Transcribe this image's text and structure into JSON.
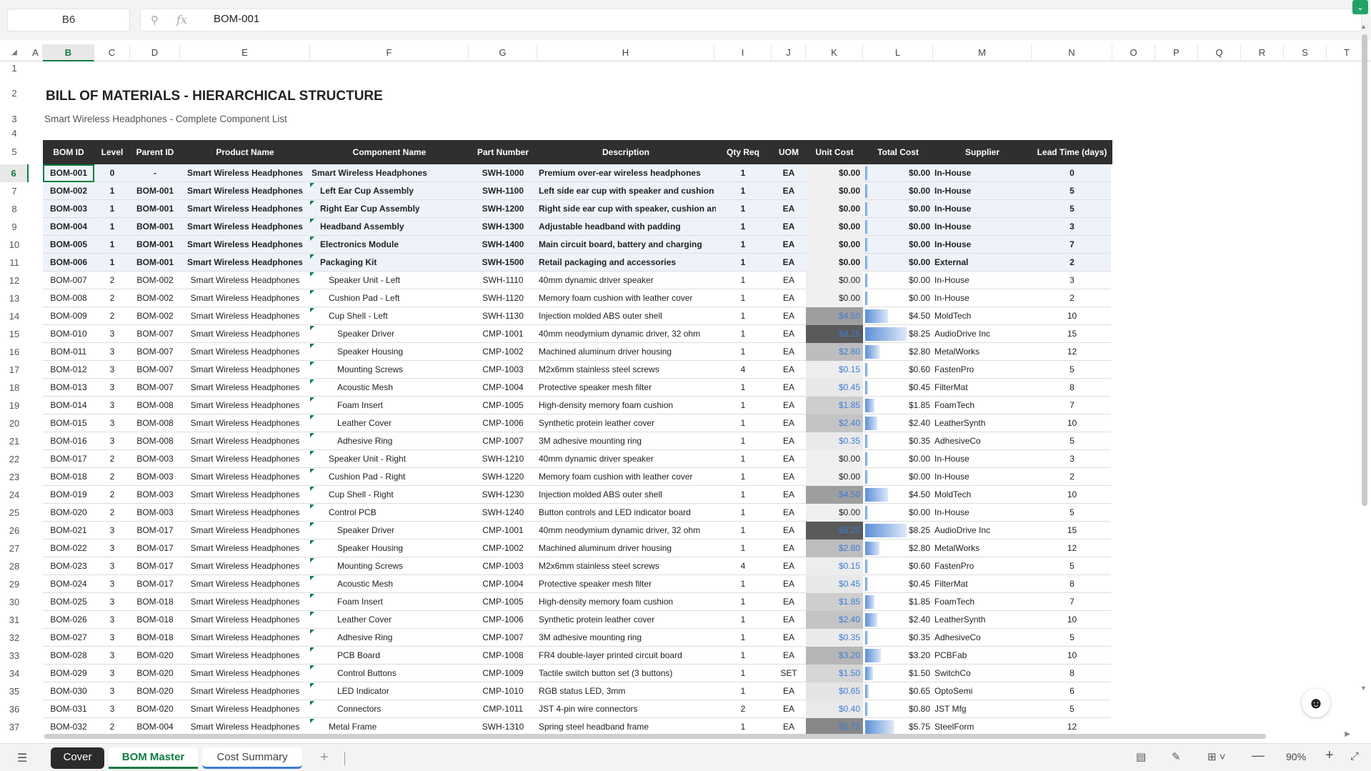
{
  "formula_bar": {
    "cell_ref": "B6",
    "fx_label": "fx",
    "formula_value": "BOM-001",
    "expand_icon": "chevron-down-icon"
  },
  "columns": [
    "A",
    "B",
    "C",
    "D",
    "E",
    "F",
    "G",
    "H",
    "I",
    "J",
    "K",
    "L",
    "M",
    "N",
    "O",
    "P",
    "Q",
    "R",
    "S",
    "T"
  ],
  "selected_column": "B",
  "selected_row": "6",
  "title": "BILL OF MATERIALS - HIERARCHICAL STRUCTURE",
  "subtitle": "Smart Wireless Headphones - Complete Component List",
  "table": {
    "headers": [
      "BOM ID",
      "Level",
      "Parent ID",
      "Product Name",
      "Component Name",
      "Part Number",
      "Description",
      "Qty Req",
      "UOM",
      "Unit Cost",
      "Total Cost",
      "Supplier",
      "Lead Time (days)"
    ],
    "rows": [
      {
        "row": "6",
        "bold": true,
        "cells": [
          "BOM-001",
          "0",
          "-",
          "Smart Wireless Headphones",
          "Smart Wireless Headphones",
          "SWH-1000",
          "Premium over-ear wireless headphones",
          "1",
          "EA",
          "$0.00",
          "$0.00",
          "In-House",
          "0"
        ],
        "indent": 0,
        "cost": 0
      },
      {
        "row": "7",
        "bold": true,
        "cells": [
          "BOM-002",
          "1",
          "BOM-001",
          "Smart Wireless Headphones",
          "Left Ear Cup Assembly",
          "SWH-1100",
          "Left side ear cup with speaker and cushion",
          "1",
          "EA",
          "$0.00",
          "$0.00",
          "In-House",
          "5"
        ],
        "indent": 1,
        "cost": 0
      },
      {
        "row": "8",
        "bold": true,
        "cells": [
          "BOM-003",
          "1",
          "BOM-001",
          "Smart Wireless Headphones",
          "Right Ear Cup Assembly",
          "SWH-1200",
          "Right side ear cup with speaker, cushion and c",
          "1",
          "EA",
          "$0.00",
          "$0.00",
          "In-House",
          "5"
        ],
        "indent": 1,
        "cost": 0
      },
      {
        "row": "9",
        "bold": true,
        "cells": [
          "BOM-004",
          "1",
          "BOM-001",
          "Smart Wireless Headphones",
          "Headband Assembly",
          "SWH-1300",
          "Adjustable headband with padding",
          "1",
          "EA",
          "$0.00",
          "$0.00",
          "In-House",
          "3"
        ],
        "indent": 1,
        "cost": 0
      },
      {
        "row": "10",
        "bold": true,
        "cells": [
          "BOM-005",
          "1",
          "BOM-001",
          "Smart Wireless Headphones",
          "Electronics Module",
          "SWH-1400",
          "Main circuit board, battery and charging",
          "1",
          "EA",
          "$0.00",
          "$0.00",
          "In-House",
          "7"
        ],
        "indent": 1,
        "cost": 0
      },
      {
        "row": "11",
        "bold": true,
        "cells": [
          "BOM-006",
          "1",
          "BOM-001",
          "Smart Wireless Headphones",
          "Packaging Kit",
          "SWH-1500",
          "Retail packaging and accessories",
          "1",
          "EA",
          "$0.00",
          "$0.00",
          "External",
          "2"
        ],
        "indent": 1,
        "cost": 0
      },
      {
        "row": "12",
        "bold": false,
        "cells": [
          "BOM-007",
          "2",
          "BOM-002",
          "Smart Wireless Headphones",
          "Speaker Unit - Left",
          "SWH-1110",
          "40mm dynamic driver speaker",
          "1",
          "EA",
          "$0.00",
          "$0.00",
          "In-House",
          "3"
        ],
        "indent": 2,
        "cost": 0
      },
      {
        "row": "13",
        "bold": false,
        "cells": [
          "BOM-008",
          "2",
          "BOM-002",
          "Smart Wireless Headphones",
          "Cushion Pad - Left",
          "SWH-1120",
          "Memory foam cushion with leather cover",
          "1",
          "EA",
          "$0.00",
          "$0.00",
          "In-House",
          "2"
        ],
        "indent": 2,
        "cost": 0
      },
      {
        "row": "14",
        "bold": false,
        "cells": [
          "BOM-009",
          "2",
          "BOM-002",
          "Smart Wireless Headphones",
          "Cup Shell - Left",
          "SWH-1130",
          "Injection molded ABS outer shell",
          "1",
          "EA",
          "$4.50",
          "$4.50",
          "MoldTech",
          "10"
        ],
        "indent": 2,
        "cost": 4.5
      },
      {
        "row": "15",
        "bold": false,
        "cells": [
          "BOM-010",
          "3",
          "BOM-007",
          "Smart Wireless Headphones",
          "Speaker Driver",
          "CMP-1001",
          "40mm neodymium dynamic driver, 32 ohm",
          "1",
          "EA",
          "$8.25",
          "$8.25",
          "AudioDrive Inc",
          "15"
        ],
        "indent": 3,
        "cost": 8.25
      },
      {
        "row": "16",
        "bold": false,
        "cells": [
          "BOM-011",
          "3",
          "BOM-007",
          "Smart Wireless Headphones",
          "Speaker Housing",
          "CMP-1002",
          "Machined aluminum driver housing",
          "1",
          "EA",
          "$2.80",
          "$2.80",
          "MetalWorks",
          "12"
        ],
        "indent": 3,
        "cost": 2.8
      },
      {
        "row": "17",
        "bold": false,
        "cells": [
          "BOM-012",
          "3",
          "BOM-007",
          "Smart Wireless Headphones",
          "Mounting Screws",
          "CMP-1003",
          "M2x6mm stainless steel screws",
          "4",
          "EA",
          "$0.15",
          "$0.60",
          "FastenPro",
          "5"
        ],
        "indent": 3,
        "cost": 0.15
      },
      {
        "row": "18",
        "bold": false,
        "cells": [
          "BOM-013",
          "3",
          "BOM-007",
          "Smart Wireless Headphones",
          "Acoustic Mesh",
          "CMP-1004",
          "Protective speaker mesh filter",
          "1",
          "EA",
          "$0.45",
          "$0.45",
          "FilterMat",
          "8"
        ],
        "indent": 3,
        "cost": 0.45
      },
      {
        "row": "19",
        "bold": false,
        "cells": [
          "BOM-014",
          "3",
          "BOM-008",
          "Smart Wireless Headphones",
          "Foam Insert",
          "CMP-1005",
          "High-density memory foam cushion",
          "1",
          "EA",
          "$1.85",
          "$1.85",
          "FoamTech",
          "7"
        ],
        "indent": 3,
        "cost": 1.85
      },
      {
        "row": "20",
        "bold": false,
        "cells": [
          "BOM-015",
          "3",
          "BOM-008",
          "Smart Wireless Headphones",
          "Leather Cover",
          "CMP-1006",
          "Synthetic protein leather cover",
          "1",
          "EA",
          "$2.40",
          "$2.40",
          "LeatherSynth",
          "10"
        ],
        "indent": 3,
        "cost": 2.4
      },
      {
        "row": "21",
        "bold": false,
        "cells": [
          "BOM-016",
          "3",
          "BOM-008",
          "Smart Wireless Headphones",
          "Adhesive Ring",
          "CMP-1007",
          "3M adhesive mounting ring",
          "1",
          "EA",
          "$0.35",
          "$0.35",
          "AdhesiveCo",
          "5"
        ],
        "indent": 3,
        "cost": 0.35
      },
      {
        "row": "22",
        "bold": false,
        "cells": [
          "BOM-017",
          "2",
          "BOM-003",
          "Smart Wireless Headphones",
          "Speaker Unit - Right",
          "SWH-1210",
          "40mm dynamic driver speaker",
          "1",
          "EA",
          "$0.00",
          "$0.00",
          "In-House",
          "3"
        ],
        "indent": 2,
        "cost": 0
      },
      {
        "row": "23",
        "bold": false,
        "cells": [
          "BOM-018",
          "2",
          "BOM-003",
          "Smart Wireless Headphones",
          "Cushion Pad - Right",
          "SWH-1220",
          "Memory foam cushion with leather cover",
          "1",
          "EA",
          "$0.00",
          "$0.00",
          "In-House",
          "2"
        ],
        "indent": 2,
        "cost": 0
      },
      {
        "row": "24",
        "bold": false,
        "cells": [
          "BOM-019",
          "2",
          "BOM-003",
          "Smart Wireless Headphones",
          "Cup Shell - Right",
          "SWH-1230",
          "Injection molded ABS outer shell",
          "1",
          "EA",
          "$4.50",
          "$4.50",
          "MoldTech",
          "10"
        ],
        "indent": 2,
        "cost": 4.5
      },
      {
        "row": "25",
        "bold": false,
        "cells": [
          "BOM-020",
          "2",
          "BOM-003",
          "Smart Wireless Headphones",
          "Control PCB",
          "SWH-1240",
          "Button controls and LED indicator board",
          "1",
          "EA",
          "$0.00",
          "$0.00",
          "In-House",
          "5"
        ],
        "indent": 2,
        "cost": 0
      },
      {
        "row": "26",
        "bold": false,
        "cells": [
          "BOM-021",
          "3",
          "BOM-017",
          "Smart Wireless Headphones",
          "Speaker Driver",
          "CMP-1001",
          "40mm neodymium dynamic driver, 32 ohm",
          "1",
          "EA",
          "$8.25",
          "$8.25",
          "AudioDrive Inc",
          "15"
        ],
        "indent": 3,
        "cost": 8.25
      },
      {
        "row": "27",
        "bold": false,
        "cells": [
          "BOM-022",
          "3",
          "BOM-017",
          "Smart Wireless Headphones",
          "Speaker Housing",
          "CMP-1002",
          "Machined aluminum driver housing",
          "1",
          "EA",
          "$2.80",
          "$2.80",
          "MetalWorks",
          "12"
        ],
        "indent": 3,
        "cost": 2.8
      },
      {
        "row": "28",
        "bold": false,
        "cells": [
          "BOM-023",
          "3",
          "BOM-017",
          "Smart Wireless Headphones",
          "Mounting Screws",
          "CMP-1003",
          "M2x6mm stainless steel screws",
          "4",
          "EA",
          "$0.15",
          "$0.60",
          "FastenPro",
          "5"
        ],
        "indent": 3,
        "cost": 0.15
      },
      {
        "row": "29",
        "bold": false,
        "cells": [
          "BOM-024",
          "3",
          "BOM-017",
          "Smart Wireless Headphones",
          "Acoustic Mesh",
          "CMP-1004",
          "Protective speaker mesh filter",
          "1",
          "EA",
          "$0.45",
          "$0.45",
          "FilterMat",
          "8"
        ],
        "indent": 3,
        "cost": 0.45
      },
      {
        "row": "30",
        "bold": false,
        "cells": [
          "BOM-025",
          "3",
          "BOM-018",
          "Smart Wireless Headphones",
          "Foam Insert",
          "CMP-1005",
          "High-density memory foam cushion",
          "1",
          "EA",
          "$1.85",
          "$1.85",
          "FoamTech",
          "7"
        ],
        "indent": 3,
        "cost": 1.85
      },
      {
        "row": "31",
        "bold": false,
        "cells": [
          "BOM-026",
          "3",
          "BOM-018",
          "Smart Wireless Headphones",
          "Leather Cover",
          "CMP-1006",
          "Synthetic protein leather cover",
          "1",
          "EA",
          "$2.40",
          "$2.40",
          "LeatherSynth",
          "10"
        ],
        "indent": 3,
        "cost": 2.4
      },
      {
        "row": "32",
        "bold": false,
        "cells": [
          "BOM-027",
          "3",
          "BOM-018",
          "Smart Wireless Headphones",
          "Adhesive Ring",
          "CMP-1007",
          "3M adhesive mounting ring",
          "1",
          "EA",
          "$0.35",
          "$0.35",
          "AdhesiveCo",
          "5"
        ],
        "indent": 3,
        "cost": 0.35
      },
      {
        "row": "33",
        "bold": false,
        "cells": [
          "BOM-028",
          "3",
          "BOM-020",
          "Smart Wireless Headphones",
          "PCB Board",
          "CMP-1008",
          "FR4 double-layer printed circuit board",
          "1",
          "EA",
          "$3.20",
          "$3.20",
          "PCBFab",
          "10"
        ],
        "indent": 3,
        "cost": 3.2
      },
      {
        "row": "34",
        "bold": false,
        "cells": [
          "BOM-029",
          "3",
          "BOM-020",
          "Smart Wireless Headphones",
          "Control Buttons",
          "CMP-1009",
          "Tactile switch button set (3 buttons)",
          "1",
          "SET",
          "$1.50",
          "$1.50",
          "SwitchCo",
          "8"
        ],
        "indent": 3,
        "cost": 1.5
      },
      {
        "row": "35",
        "bold": false,
        "cells": [
          "BOM-030",
          "3",
          "BOM-020",
          "Smart Wireless Headphones",
          "LED Indicator",
          "CMP-1010",
          "RGB status LED, 3mm",
          "1",
          "EA",
          "$0.65",
          "$0.65",
          "OptoSemi",
          "6"
        ],
        "indent": 3,
        "cost": 0.65
      },
      {
        "row": "36",
        "bold": false,
        "cells": [
          "BOM-031",
          "3",
          "BOM-020",
          "Smart Wireless Headphones",
          "Connectors",
          "CMP-1011",
          "JST 4-pin wire connectors",
          "2",
          "EA",
          "$0.40",
          "$0.80",
          "JST Mfg",
          "5"
        ],
        "indent": 3,
        "cost": 0.4
      },
      {
        "row": "37",
        "bold": false,
        "cells": [
          "BOM-032",
          "2",
          "BOM-004",
          "Smart Wireless Headphones",
          "Metal Frame",
          "SWH-1310",
          "Spring steel headband frame",
          "1",
          "EA",
          "$5.75",
          "$5.75",
          "SteelForm",
          "12"
        ],
        "indent": 2,
        "cost": 5.75
      }
    ]
  },
  "sheet_tabs": [
    "Cover",
    "BOM Master",
    "Cost Summary"
  ],
  "active_sheet": "BOM Master",
  "zoom_level": "90%",
  "colors": {
    "accent": "#107c41",
    "header_bg": "#2f2f2f",
    "bold_row_bg": "#eef3fa",
    "cost_blue": "#3b7dd8"
  },
  "icons": {
    "sheets": "layers-icon",
    "search": "search-icon",
    "assistant": "assistant-icon"
  }
}
